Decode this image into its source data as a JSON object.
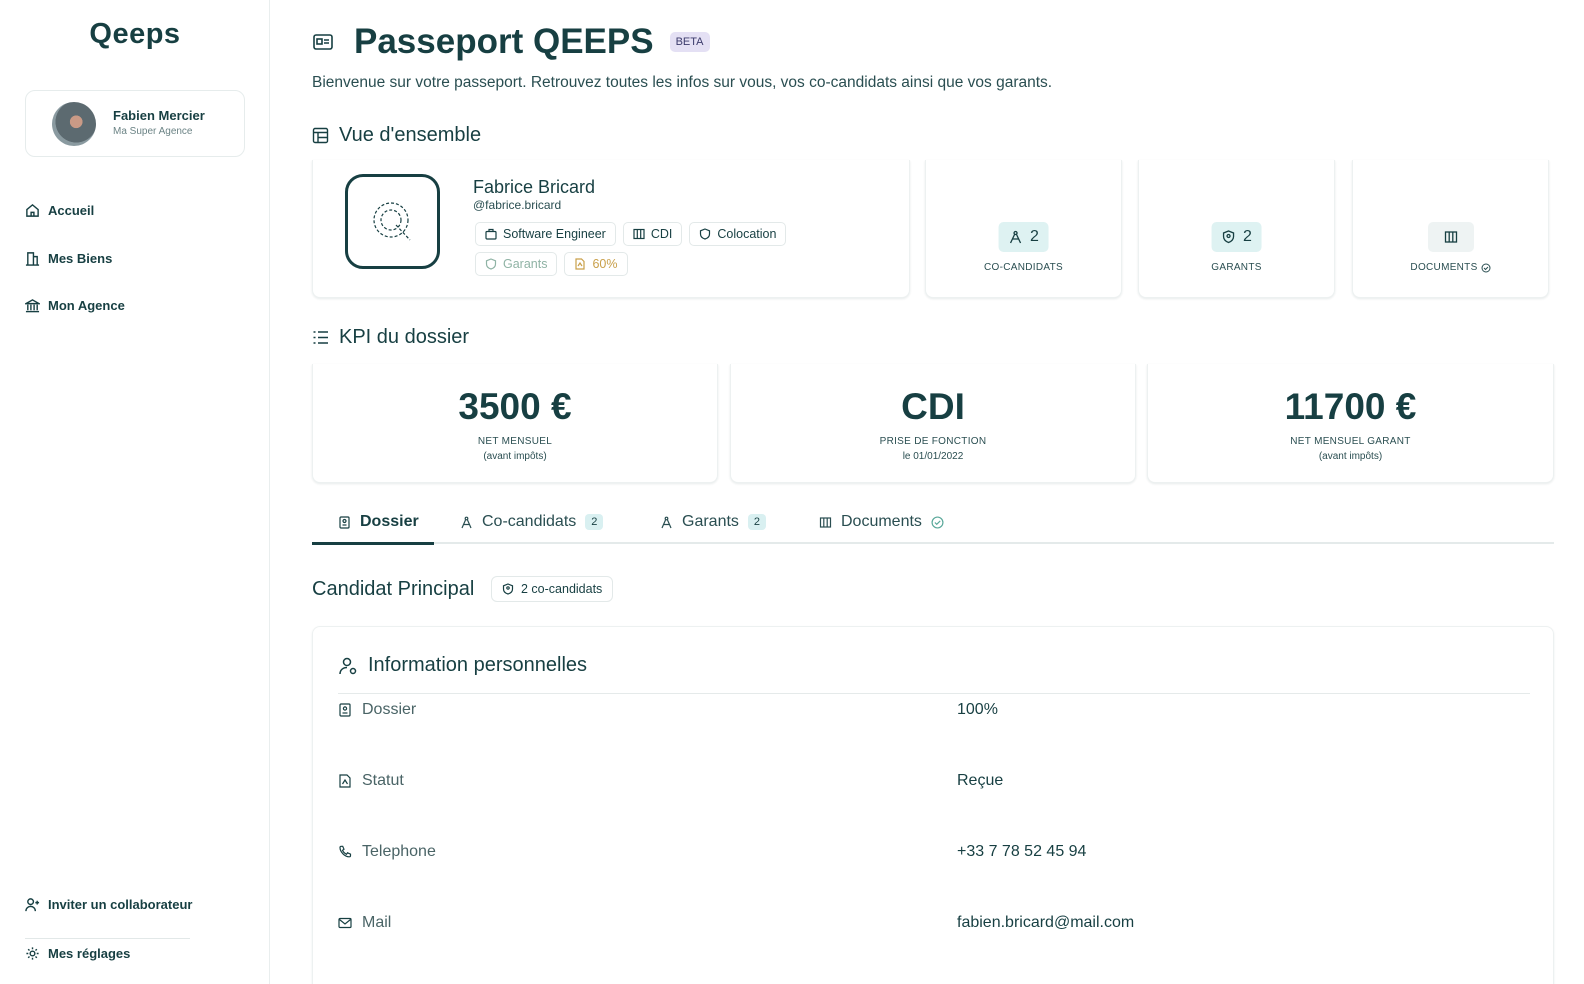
{
  "app": {
    "logo": "Qeeps"
  },
  "profile": {
    "name": "Fabien Mercier",
    "agency": "Ma Super Agence"
  },
  "nav": {
    "items": [
      {
        "label": "Accueil",
        "icon": "home-icon"
      },
      {
        "label": "Mes Biens",
        "icon": "building-icon"
      },
      {
        "label": "Mon Agence",
        "icon": "bank-icon"
      }
    ],
    "bottom": [
      {
        "label": "Inviter un collaborateur",
        "icon": "user-plus-icon"
      },
      {
        "label": "Mes réglages",
        "icon": "gear-icon"
      }
    ]
  },
  "header": {
    "title": "Passeport QEEPS",
    "badge": "BETA",
    "subtitle": "Bienvenue sur votre passeport. Retrouvez toutes les infos sur vous, vos co-candidats ainsi que vos garants."
  },
  "overview": {
    "heading": "Vue d'ensemble",
    "person": {
      "name": "Fabrice Bricard",
      "handle": "@fabrice.bricard",
      "tags": [
        "Software Engineer",
        "CDI",
        "Colocation"
      ],
      "tags2": [
        "Garants",
        "60%"
      ]
    },
    "stats": [
      {
        "value": "2",
        "label": "CO-CANDIDATS"
      },
      {
        "value": "2",
        "label": "GARANTS"
      },
      {
        "value": "",
        "label": "DOCUMENTS"
      }
    ]
  },
  "kpi": {
    "heading": "KPI du dossier",
    "items": [
      {
        "value": "3500 €",
        "label": "NET MENSUEL",
        "sub": "(avant impôts)"
      },
      {
        "value": "CDI",
        "label": "PRISE DE FONCTION",
        "sub": "le 01/01/2022"
      },
      {
        "value": "11700 €",
        "label": "NET MENSUEL GARANT",
        "sub": "(avant impôts)"
      }
    ]
  },
  "tabs": [
    {
      "label": "Dossier",
      "count": ""
    },
    {
      "label": "Co-candidats",
      "count": "2"
    },
    {
      "label": "Garants",
      "count": "2"
    },
    {
      "label": "Documents",
      "count": ""
    }
  ],
  "candidate": {
    "title": "Candidat Principal",
    "badge": "2 co-candidats"
  },
  "info": {
    "title": "Information personnelles",
    "rows": [
      {
        "key": "Dossier",
        "value": "100%"
      },
      {
        "key": "Statut",
        "value": "Reçue"
      },
      {
        "key": "Telephone",
        "value": "+33 7 78 52 45 94"
      },
      {
        "key": "Mail",
        "value": "fabien.bricard@mail.com"
      }
    ]
  },
  "colors": {
    "primary": "#173f42",
    "badge_bg": "#def2f2",
    "beta_bg": "#e4e0f4"
  }
}
